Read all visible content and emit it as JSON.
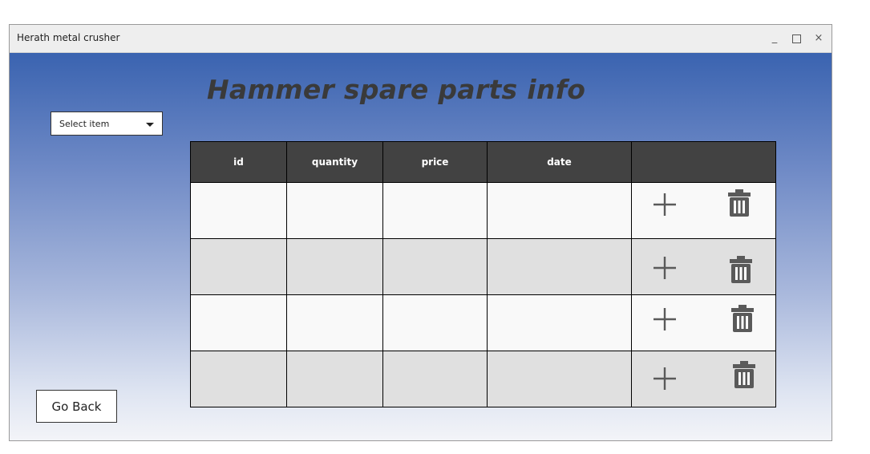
{
  "window": {
    "title": "Herath metal crusher",
    "controls": {
      "minimize": "_",
      "maximize": "□",
      "close": "×"
    }
  },
  "main": {
    "page_title": "Hammer spare parts info",
    "select": {
      "value": "Select item"
    },
    "go_back_label": "Go Back"
  },
  "table": {
    "columns": [
      "id",
      "quantity",
      "price",
      "date",
      ""
    ],
    "rows": [
      {
        "id": "",
        "quantity": "",
        "price": "",
        "date": ""
      },
      {
        "id": "",
        "quantity": "",
        "price": "",
        "date": ""
      },
      {
        "id": "",
        "quantity": "",
        "price": "",
        "date": ""
      },
      {
        "id": "",
        "quantity": "",
        "price": "",
        "date": ""
      }
    ],
    "row_actions": [
      "plus-icon",
      "trash-icon"
    ]
  },
  "colors": {
    "header_bg": "#424242",
    "row_light": "#f9f9f9",
    "row_dark": "#e0e0e0",
    "gradient_top": "#3a63b0",
    "gradient_bottom": "#f3f4f8",
    "icon_color": "#5a5a5a"
  }
}
